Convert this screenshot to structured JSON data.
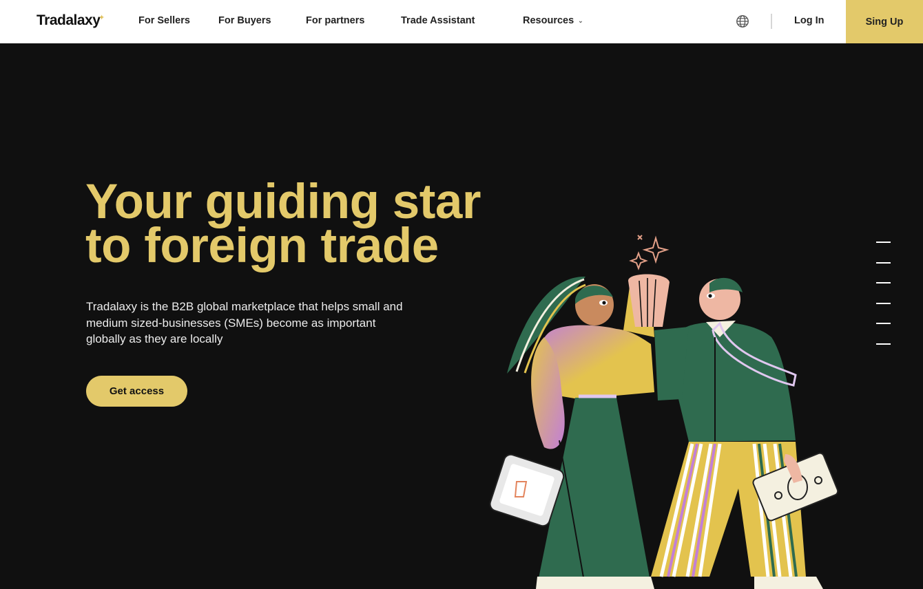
{
  "header": {
    "logo_text": "Tradalaxy",
    "logo_star": "✦",
    "nav": [
      {
        "label": "For Sellers"
      },
      {
        "label": "For Buyers"
      },
      {
        "label": "For partners"
      },
      {
        "label": "Trade Assistant"
      },
      {
        "label": "Resources"
      }
    ],
    "resources_chevron": "⌄",
    "globe_icon": "globe-icon",
    "login_label": "Log In",
    "signup_label": "Sing Up"
  },
  "hero": {
    "title_line1": "Your guiding star",
    "title_line2": "to foreign trade",
    "description": "Tradalaxy is the B2B global marketplace that helps small and medium sized-businesses (SMEs) become as important globally  as they are locally",
    "cta_label": "Get access"
  },
  "slider_nav": {
    "count": 6
  },
  "colors": {
    "accent": "#e3c96a",
    "background": "#101010",
    "header_bg": "#ffffff",
    "green": "#2f6b4f",
    "pink": "#e38a9c",
    "purple": "#b07ad2"
  }
}
